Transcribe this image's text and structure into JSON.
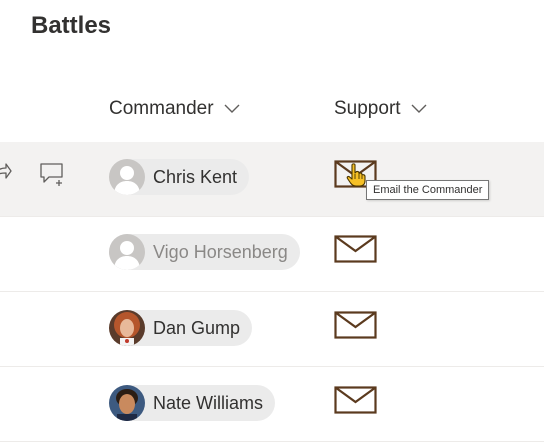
{
  "page": {
    "title": "Battles"
  },
  "columns": {
    "commander": "Commander",
    "support": "Support"
  },
  "rows": [
    {
      "commander": "Chris Kent",
      "avatar": "placeholder",
      "name_muted": false
    },
    {
      "commander": "Vigo Horsenberg",
      "avatar": "placeholder",
      "name_muted": true
    },
    {
      "commander": "Dan Gump",
      "avatar": "photo-red-hair",
      "name_muted": false
    },
    {
      "commander": "Nate Williams",
      "avatar": "photo-dark-hair",
      "name_muted": false
    }
  ],
  "tooltip": {
    "text": "Email the Commander"
  },
  "icons": {
    "share": "share-icon",
    "comment": "add-comment-icon",
    "mail": "mail-icon",
    "sort": "chevron-down-icon",
    "cursor": "hand-pointer-icon"
  },
  "colors": {
    "mail_stroke": "#5b3a1e",
    "row_hover": "#f3f2f1",
    "persona_bg": "#ebebeb"
  }
}
